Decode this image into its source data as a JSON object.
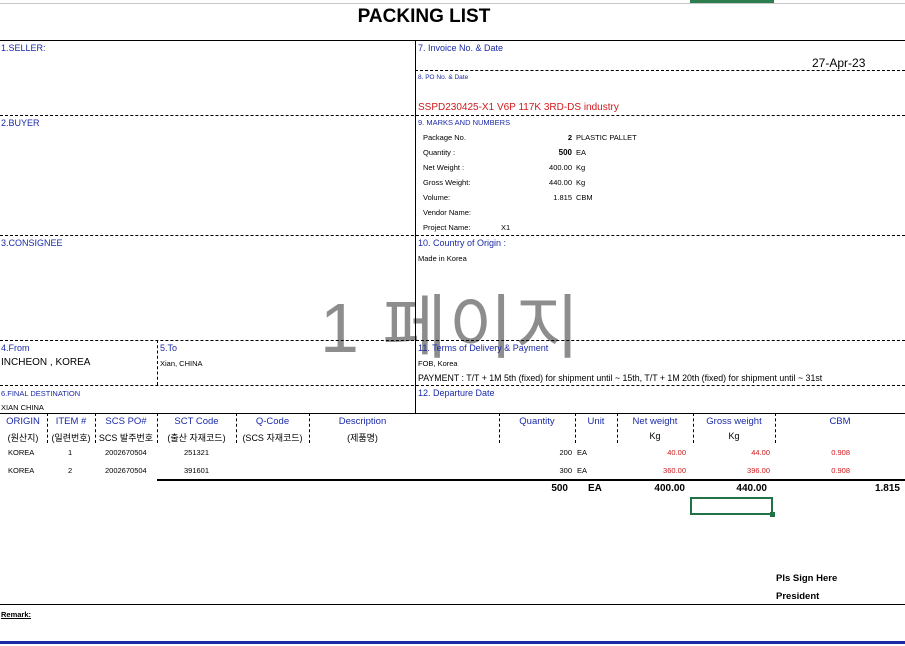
{
  "title": "PACKING LIST",
  "watermark": "1 페이지",
  "seller": {
    "label": "1.SELLER:"
  },
  "invoice": {
    "label": "7. Invoice No. & Date",
    "date": "27-Apr-23"
  },
  "po": {
    "label": "8. PO No. & Date",
    "value": "SSPD230425-X1 V6P 117K 3RD-DS industry"
  },
  "buyer": {
    "label": "2.BUYER"
  },
  "marks": {
    "label": "9. MARKS AND NUMBERS",
    "rows": [
      {
        "name": "Package No.",
        "value": "2",
        "unit": "PLASTIC PALLET"
      },
      {
        "name": "Quantity :",
        "value": "500",
        "unit": "EA"
      },
      {
        "name": "Net Weight :",
        "value": "400.00",
        "unit": "Kg"
      },
      {
        "name": "Gross Weight:",
        "value": "440.00",
        "unit": "Kg"
      },
      {
        "name": "Volume:",
        "value": "1.815",
        "unit": "CBM"
      },
      {
        "name": "Vendor Name:",
        "value": "",
        "unit": ""
      },
      {
        "name": "Project Name:",
        "value": "X1",
        "unit": ""
      }
    ]
  },
  "consignee": {
    "label": "3.CONSIGNEE"
  },
  "origin_country": {
    "label": "10. Country of Origin :",
    "value": "Made in Korea"
  },
  "from": {
    "label": "4.From",
    "value": "INCHEON , KOREA"
  },
  "to": {
    "label": "5.To",
    "value": "Xian, CHINA"
  },
  "terms": {
    "label": "11. Terms of Delivery & Payment",
    "line1": "FOB, Korea",
    "line2": "PAYMENT : T/T + 1M 5th (fixed) for shipment until ~ 15th,  T/T + 1M 20th (fixed) for shipment until ~ 31st"
  },
  "final_dest": {
    "label": "6.FINAL DESTINATION",
    "value": "XIAN CHINA"
  },
  "departure": {
    "label": "12. Departure Date"
  },
  "table": {
    "headers": [
      "ORIGIN",
      "ITEM #",
      "SCS PO#",
      "SCT Code",
      "Q-Code",
      "Description",
      "Quantity",
      "Unit",
      "Net weight",
      "Gross weight",
      "CBM"
    ],
    "subheaders": [
      "(원산지)",
      "(일련번호)",
      "SCS 발주번호",
      "(출산 자재코드)",
      "(SCS 자재코드)",
      "(제품명)",
      "Kg",
      "Kg"
    ],
    "rows": [
      {
        "origin": "KOREA",
        "item": "1",
        "po": "2002670504",
        "sct": "251321",
        "qty": "200",
        "unit": "EA",
        "net": "40.00",
        "gross": "44.00",
        "cbm": "0.908"
      },
      {
        "origin": "KOREA",
        "item": "2",
        "po": "2002670504",
        "sct": "391601",
        "qty": "300",
        "unit": "EA",
        "net": "360.00",
        "gross": "396.00",
        "cbm": "0.908"
      }
    ],
    "totals": {
      "qty": "500",
      "unit": "EA",
      "net": "400.00",
      "gross": "440.00",
      "cbm": "1.815"
    }
  },
  "sign": {
    "line1": "Pls Sign Here",
    "line2": "President"
  },
  "remark": {
    "label": "Remark:"
  }
}
